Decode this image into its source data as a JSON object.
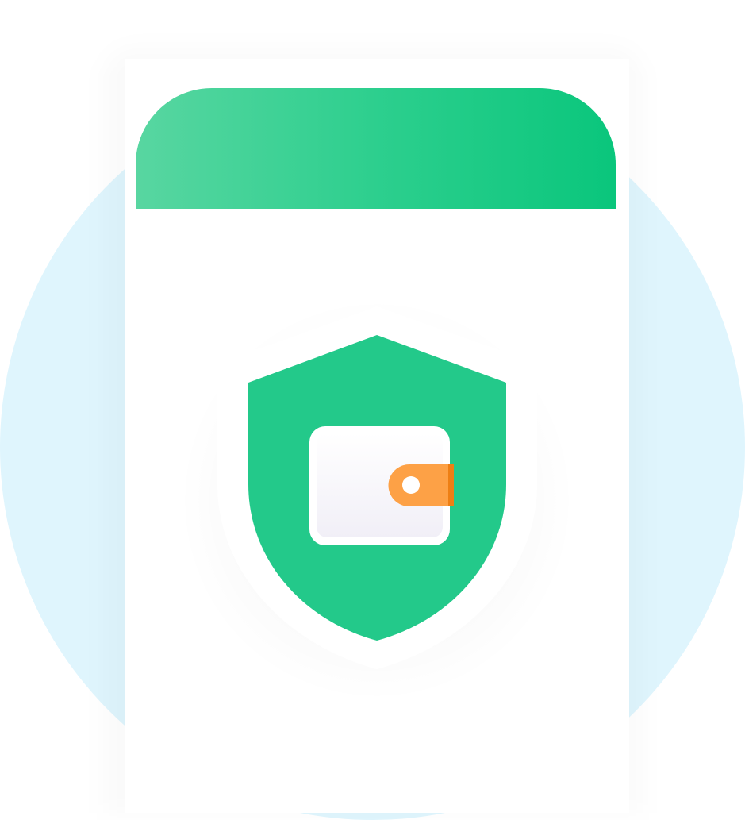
{
  "illustration": {
    "icon": "shield-wallet-icon",
    "colors": {
      "background_circle": "#dff5fd",
      "header_gradient_start": "#58d6a1",
      "header_gradient_end": "#0ac67c",
      "shield_fill": "#23c98a",
      "shield_border": "#ffffff",
      "wallet_body": "#f3f2f8",
      "wallet_clasp": "#fda146",
      "wallet_clasp_edge": "#ee7f14"
    }
  }
}
